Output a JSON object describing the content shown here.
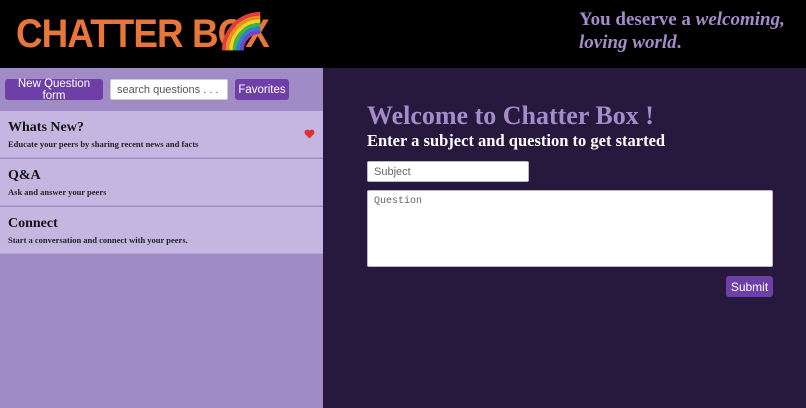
{
  "header": {
    "logo_text": "CHATTER BOX",
    "tagline_prefix": "You deserve a ",
    "tagline_em1": "welcoming,",
    "tagline_em2": "loving world",
    "tagline_suffix": "."
  },
  "sidebar": {
    "new_question_label": "New Question form",
    "search_placeholder": "search questions . . .",
    "favorites_label": "Favorites",
    "categories": [
      {
        "title": "Whats New?",
        "description": "Educate your peers by sharing recent news and facts",
        "favorited": true
      },
      {
        "title": "Q&A",
        "description": "Ask and answer your peers",
        "favorited": false
      },
      {
        "title": "Connect",
        "description": "Start a conversation and connect with your peers.",
        "favorited": false
      }
    ]
  },
  "main": {
    "welcome": "Welcome to Chatter Box !",
    "subtitle": "Enter a subject and question to get started",
    "subject_placeholder": "Subject",
    "question_placeholder": "Question",
    "submit_label": "Submit"
  },
  "colors": {
    "header_bg": "#000000",
    "logo": "#e8763a",
    "tagline": "#a58bc9",
    "sidebar_bg": "#a18bc6",
    "category_bg": "#c5b6e1",
    "button": "#6e3fa6",
    "main_bg": "#27183e",
    "heart": "#e03030"
  },
  "icons": {
    "logo_decoration": "rainbow-icon",
    "favorite": "heart-icon"
  }
}
